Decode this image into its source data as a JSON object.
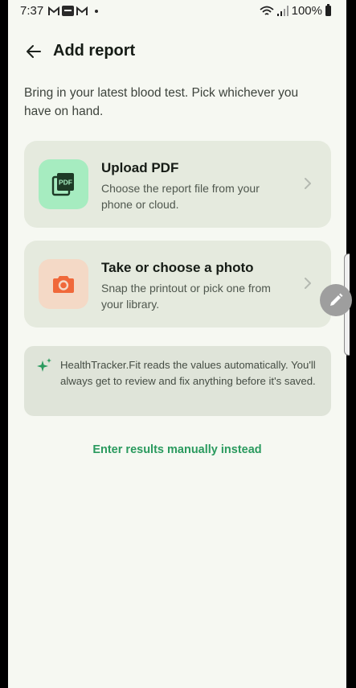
{
  "status_bar": {
    "time": "7:37",
    "battery": "100%"
  },
  "header": {
    "title": "Add report"
  },
  "intro_text": "Bring in your latest blood test. Pick whichever you have on hand.",
  "options": [
    {
      "title": "Upload PDF",
      "description": "Choose the report file from your phone or cloud.",
      "icon": "pdf-file-icon",
      "icon_label": "PDF",
      "icon_bg": "#a6ecc0",
      "icon_color": "#1d3a26"
    },
    {
      "title": "Take or choose a photo",
      "description": "Snap the printout or pick one from your library.",
      "icon": "camera-icon",
      "icon_bg": "#f4d9c6",
      "icon_color": "#f0683a"
    }
  ],
  "info": {
    "text": "HealthTracker.Fit reads the values automatically. You'll always get to review and fix anything before it's saved.",
    "icon": "sparkle-icon"
  },
  "manual_link": "Enter results manually instead",
  "colors": {
    "background": "#f6f8f2",
    "card": "#e5eade",
    "accent_green": "#2a9a5e"
  }
}
